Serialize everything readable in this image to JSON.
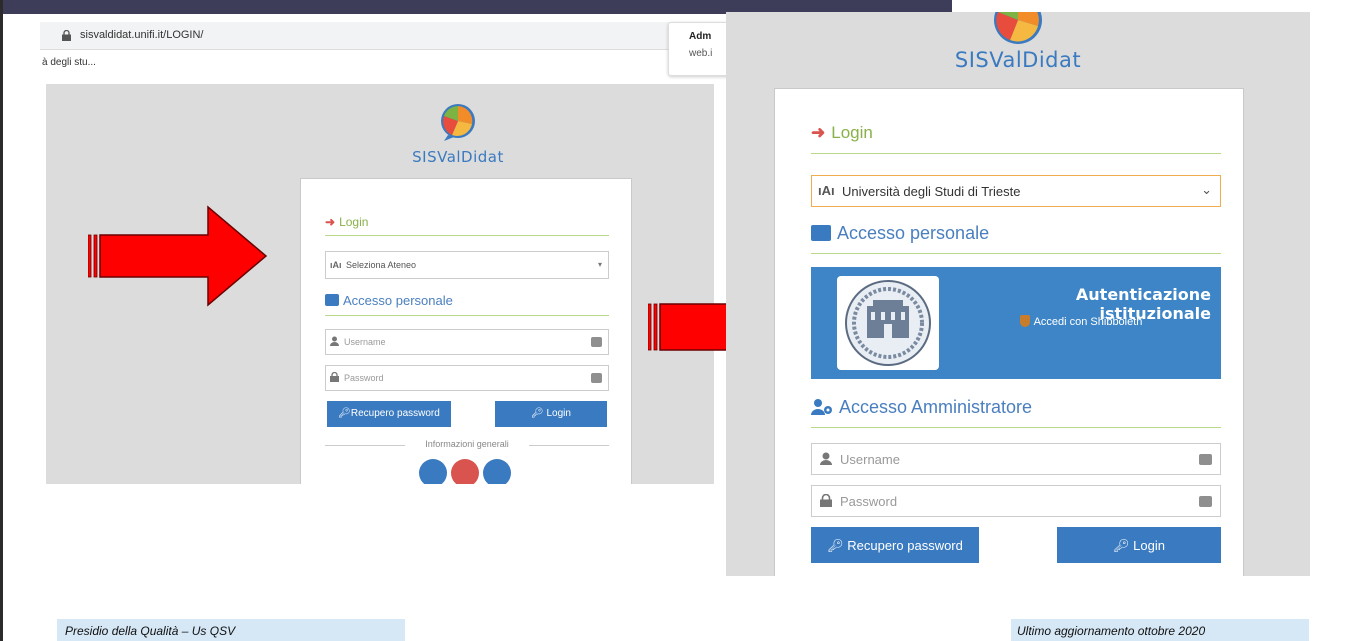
{
  "browser": {
    "url": "sisvaldidat.unifi.it/LOGIN/",
    "bookmark": "à degli stu...",
    "popup_title": "Adm",
    "popup_sub": "web.i"
  },
  "brand": "SISValDidat",
  "small_form": {
    "login_heading": "Login",
    "select_placeholder": "Seleziona Ateneo",
    "access_heading": "Accesso personale",
    "username_placeholder": "Username",
    "password_placeholder": "Password",
    "recover_button": "Recupero password",
    "login_button": "Login",
    "info_heading": "Informazioni generali"
  },
  "big_form": {
    "login_heading": "Login",
    "selected_university": "Università degli Studi di Trieste",
    "access_heading": "Accesso personale",
    "banner_title": "Autenticazione istituzionale",
    "banner_link": "Accedi con Shibboleth",
    "admin_heading": "Accesso Amministratore",
    "username_placeholder": "Username",
    "password_placeholder": "Password",
    "recover_button": "Recupero password",
    "login_button": "Login"
  },
  "colors": {
    "brand_blue": "#3a7ac0",
    "login_green": "#8ab04a",
    "arrow_red": "#ff0000",
    "banner_blue": "#3d85c6"
  },
  "footer": {
    "left": "Presidio della Qualità – Us QSV",
    "right": "Ultimo aggiornamento ottobre 2020"
  }
}
